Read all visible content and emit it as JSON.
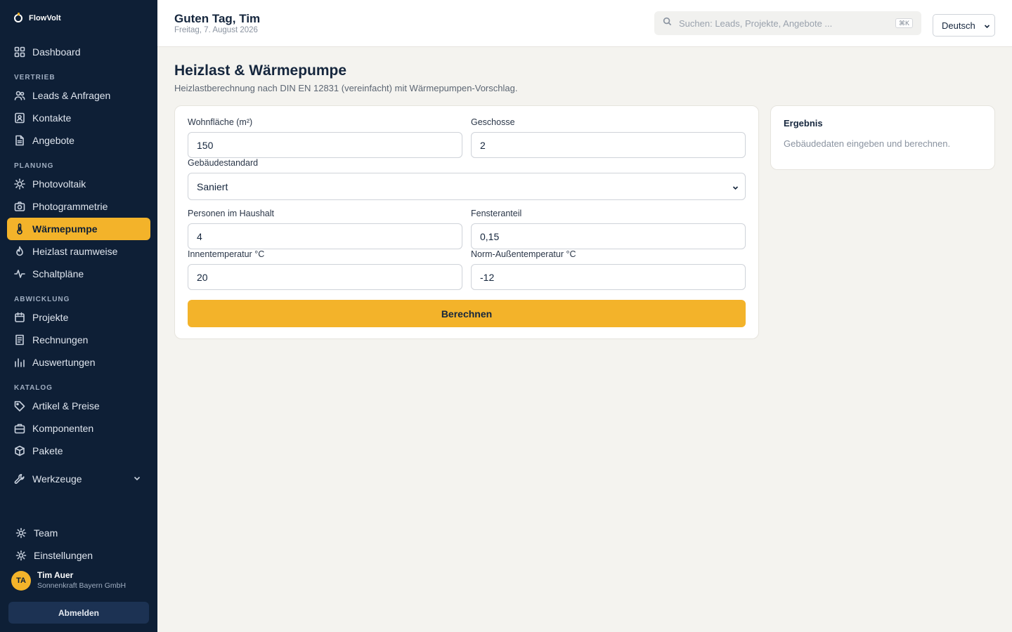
{
  "app": {
    "name": "FlowVolt"
  },
  "sidebar": {
    "dashboard": "Dashboard",
    "sections": {
      "vertrieb": "VERTRIEB",
      "planung": "PLANUNG",
      "abwicklung": "ABWICKLUNG",
      "katalog": "KATALOG"
    },
    "items": {
      "leads": "Leads & Anfragen",
      "kontakte": "Kontakte",
      "angebote": "Angebote",
      "photovoltaik": "Photovoltaik",
      "photogrammetrie": "Photogrammetrie",
      "waermepumpe": "Wärmepumpe",
      "heizlast": "Heizlast raumweise",
      "schaltplaene": "Schaltpläne",
      "projekte": "Projekte",
      "rechnungen": "Rechnungen",
      "auswertungen": "Auswertungen",
      "artikel": "Artikel & Preise",
      "komponenten": "Komponenten",
      "pakete": "Pakete",
      "werkzeuge": "Werkzeuge",
      "team": "Team",
      "einstellungen": "Einstellungen"
    },
    "active_item": "waermepumpe",
    "user": {
      "initials": "TA",
      "name": "Tim Auer",
      "company": "Sonnenkraft Bayern GmbH"
    },
    "logout_label": "Abmelden"
  },
  "header": {
    "greeting": "Guten Tag, Tim",
    "date": "Freitag, 7. August 2026",
    "search_placeholder": "Suchen: Leads, Projekte, Angebote ...",
    "search_shortcut": "⌘K",
    "language": "Deutsch"
  },
  "main": {
    "title": "Heizlast & Wärmepumpe",
    "subtitle": "Heizlastberechnung nach DIN EN 12831 (vereinfacht) mit Wärmepumpen-Vorschlag.",
    "form": {
      "wohnflaeche": {
        "label": "Wohnfläche (m²)",
        "value": "150"
      },
      "geschosse": {
        "label": "Geschosse",
        "value": "2"
      },
      "gebaeudestandard": {
        "label": "Gebäudestandard",
        "value": "Saniert"
      },
      "personen": {
        "label": "Personen im Haushalt",
        "value": "4"
      },
      "fensteranteil": {
        "label": "Fensteranteil",
        "value": "0,15"
      },
      "innentemperatur": {
        "label": "Innentemperatur °C",
        "value": "20"
      },
      "aussentemperatur": {
        "label": "Norm-Außentemperatur °C",
        "value": "-12"
      },
      "submit_label": "Berechnen"
    },
    "result": {
      "title": "Ergebnis",
      "empty_text": "Gebäudedaten eingeben und berechnen."
    }
  },
  "colors": {
    "sidebar_bg": "#0e1f36",
    "accent": "#f3b32a",
    "page_bg": "#f4f3ef"
  }
}
